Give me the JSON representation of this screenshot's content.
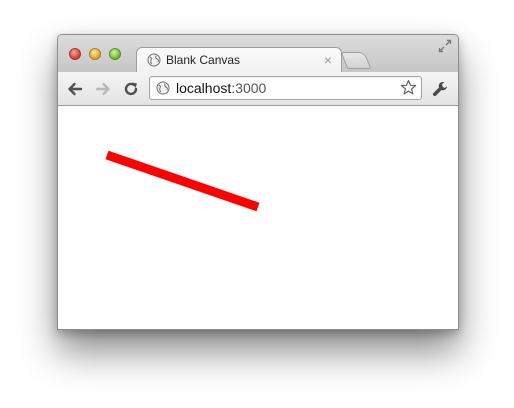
{
  "window": {
    "tab": {
      "title": "Blank Canvas",
      "icon": "globe-icon",
      "close_glyph": "×"
    },
    "omnibox": {
      "host": "localhost",
      "port": ":3000",
      "icon": "globe-icon",
      "bookmark_icon": "star-icon"
    },
    "toolbar_icons": [
      "back-arrow-icon",
      "forward-arrow-icon",
      "reload-icon",
      "wrench-icon"
    ]
  },
  "canvas": {
    "stroke_color": "#ff0000",
    "background": "#ffffff"
  }
}
